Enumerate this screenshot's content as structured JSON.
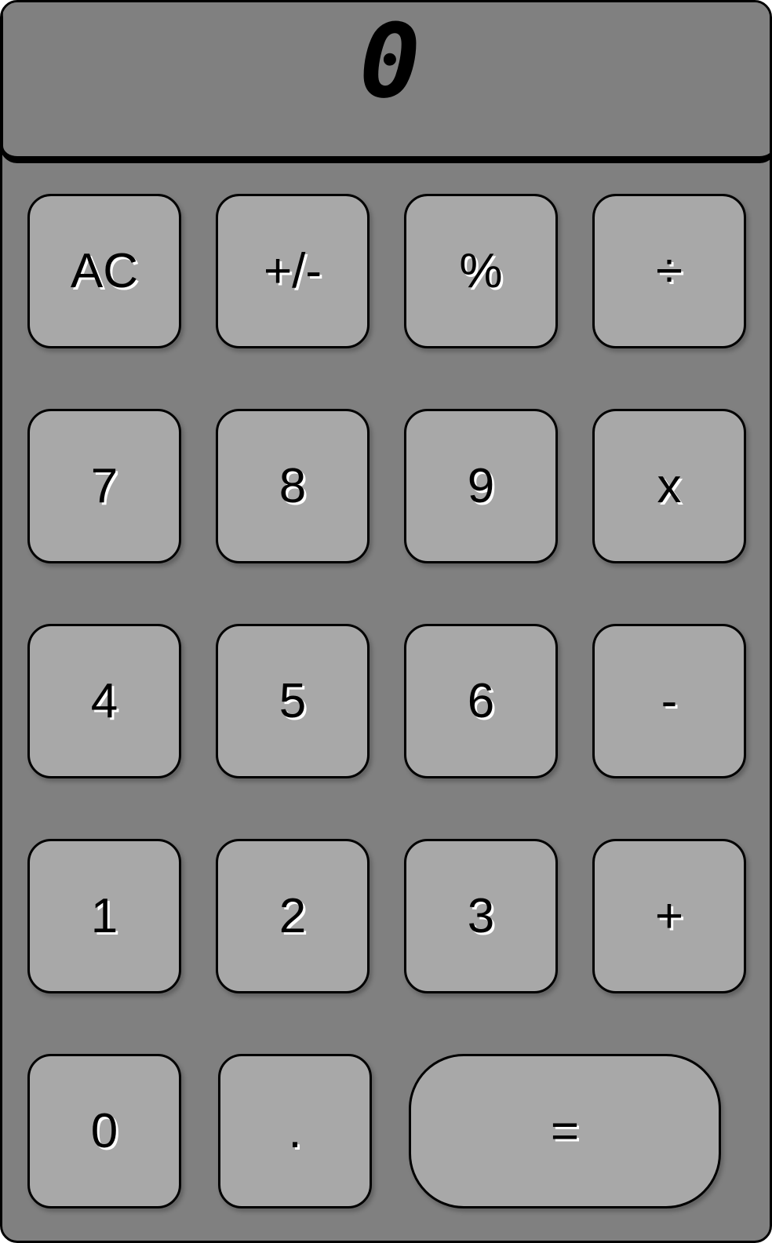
{
  "display": {
    "value": "0"
  },
  "keys": {
    "row1": [
      "AC",
      "+/-",
      "%",
      "÷"
    ],
    "row2": [
      "7",
      "8",
      "9",
      "x"
    ],
    "row3": [
      "4",
      "5",
      "6",
      "-"
    ],
    "row4": [
      "1",
      "2",
      "3",
      "+"
    ],
    "row5": [
      "0",
      ".",
      "="
    ]
  },
  "colors": {
    "body": "#808080",
    "key": "#a8a8a8",
    "outline": "#000000",
    "label_shadow": "#ffffff"
  }
}
